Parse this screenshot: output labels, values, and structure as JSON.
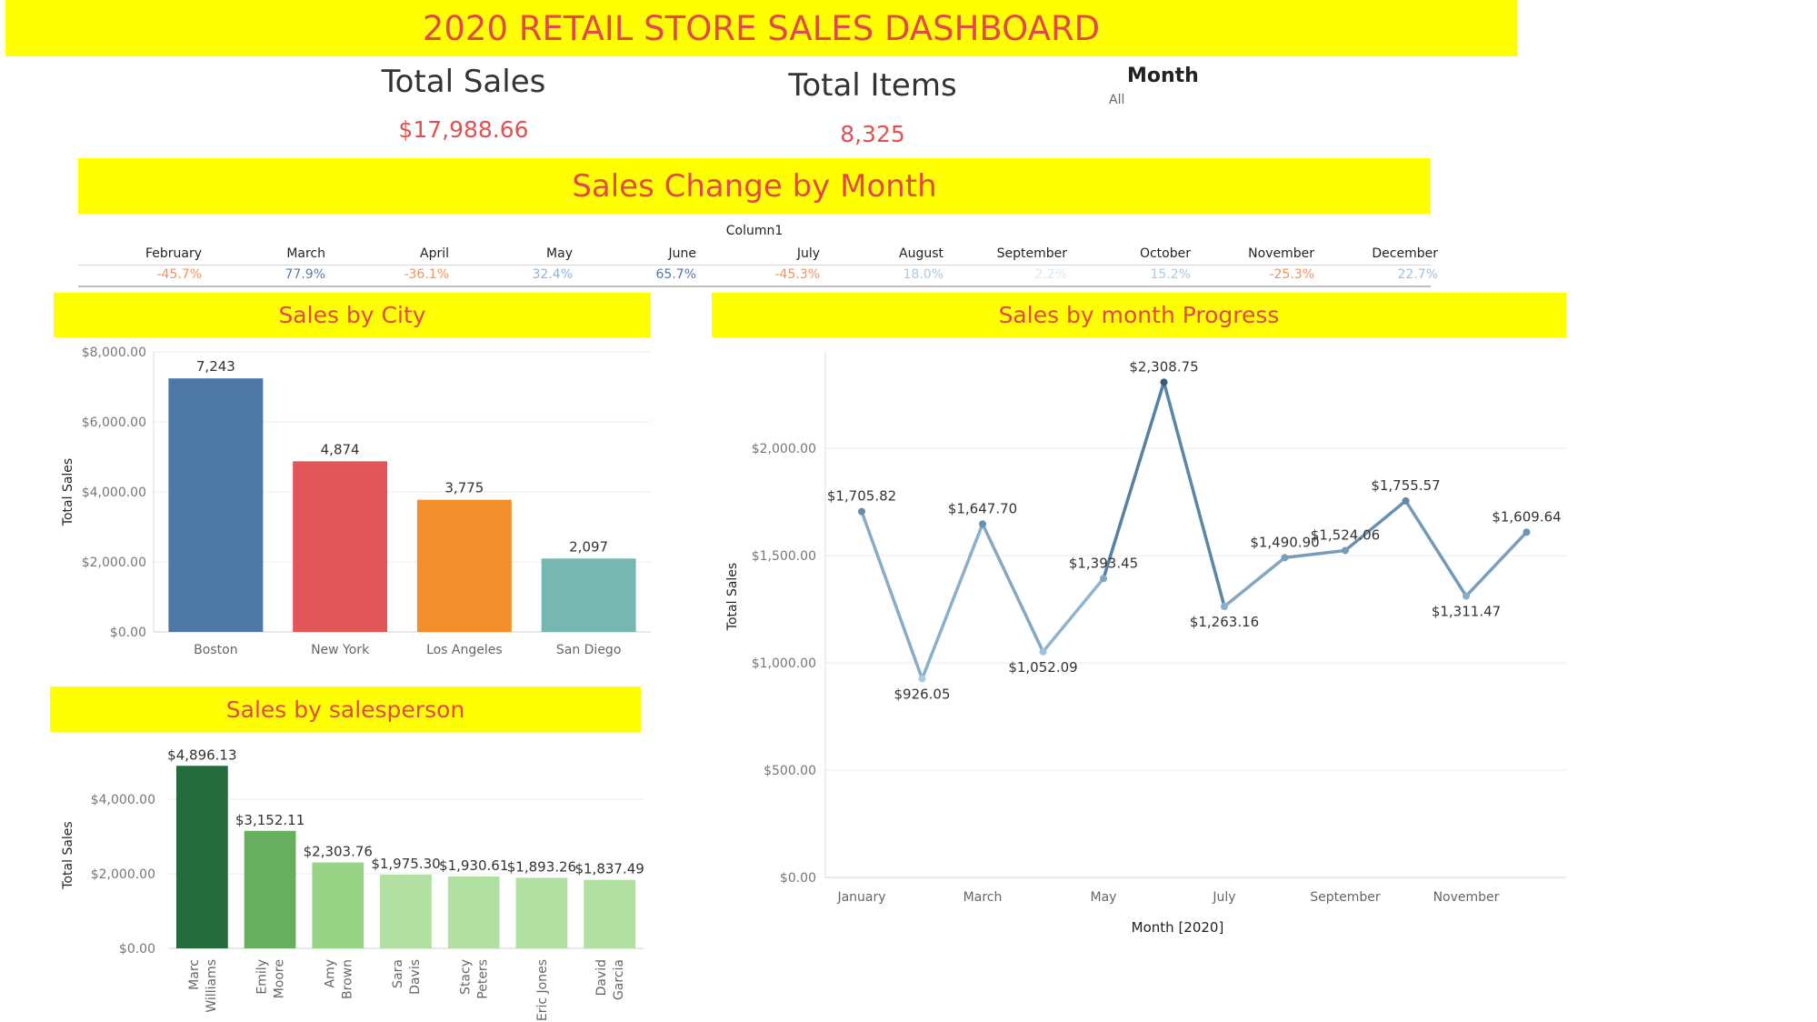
{
  "dashboard": {
    "title": "2020 RETAIL STORE SALES DASHBOARD",
    "kpis": {
      "total_sales_label": "Total Sales",
      "total_sales_value": "$17,988.66",
      "total_items_label": "Total Items",
      "total_items_value": "8,325"
    },
    "filter": {
      "label": "Month",
      "value": "All"
    }
  },
  "sales_change": {
    "title": "Sales Change by Month",
    "column_header": "Column1",
    "months": [
      "February",
      "March",
      "April",
      "May",
      "June",
      "July",
      "August",
      "September",
      "October",
      "November",
      "December"
    ],
    "values": [
      "-45.7%",
      "77.9%",
      "-36.1%",
      "32.4%",
      "65.7%",
      "-45.3%",
      "18.0%",
      "2.2%",
      "15.2%",
      "-25.3%",
      "22.7%"
    ],
    "colors": [
      "#f0935c",
      "#5b7fa6",
      "#f0935c",
      "#8fb4d6",
      "#4f79a8",
      "#f0935c",
      "#a9cce4",
      "#dbe8f1",
      "#a9cce4",
      "#f0935c",
      "#9cc3de"
    ]
  },
  "chart_data": [
    {
      "type": "bar",
      "title": "Sales by City",
      "ylabel": "Total Sales",
      "categories": [
        "Boston",
        "New York",
        "Los Angeles",
        "San Diego"
      ],
      "values": [
        7243,
        4874,
        3775,
        2097
      ],
      "data_labels": [
        "7,243",
        "4,874",
        "3,775",
        "2,097"
      ],
      "colors": [
        "#4e79a7",
        "#e15759",
        "#f28e2b",
        "#76b7b2"
      ],
      "yticks": [
        0,
        2000,
        4000,
        6000,
        8000
      ],
      "ytick_labels": [
        "$0.00",
        "$2,000.00",
        "$4,000.00",
        "$6,000.00",
        "$8,000.00"
      ],
      "ylim": [
        0,
        8000
      ],
      "grid": true
    },
    {
      "type": "bar",
      "title": "Sales by salesperson",
      "ylabel": "Total Sales",
      "categories": [
        "Marc Williams",
        "Emily Moore",
        "Amy Brown",
        "Sara Davis",
        "Stacy Peters",
        "Eric Jones",
        "David Garcia"
      ],
      "category_lines": [
        [
          "Marc",
          "Williams"
        ],
        [
          "Emily",
          "Moore"
        ],
        [
          "Amy",
          "Brown"
        ],
        [
          "Sara",
          "Davis"
        ],
        [
          "Stacy",
          "Peters"
        ],
        [
          "Eric Jones"
        ],
        [
          "David",
          "Garcia"
        ]
      ],
      "values": [
        4896.13,
        3152.11,
        2303.76,
        1975.3,
        1930.61,
        1893.26,
        1837.49
      ],
      "data_labels": [
        "$4,896.13",
        "$3,152.11",
        "$2,303.76",
        "$1,975.30",
        "$1,930.61",
        "$1,893.26",
        "$1,837.49"
      ],
      "colors": [
        "#256b3d",
        "#67ae5f",
        "#98d485",
        "#b2e0a3",
        "#b2e0a3",
        "#b2e0a3",
        "#b2e0a3"
      ],
      "yticks": [
        0,
        2000,
        4000
      ],
      "ytick_labels": [
        "$0.00",
        "$2,000.00",
        "$4,000.00"
      ],
      "ylim": [
        0,
        5000
      ],
      "grid": true
    },
    {
      "type": "line",
      "title": "Sales by month Progress",
      "xlabel": "Month [2020]",
      "ylabel": "Total Sales",
      "x": [
        "January",
        "February",
        "March",
        "April",
        "May",
        "June",
        "July",
        "August",
        "September",
        "October",
        "November",
        "December"
      ],
      "values": [
        1705.82,
        926.05,
        1647.7,
        1052.09,
        1393.45,
        2308.75,
        1263.16,
        1490.9,
        1524.06,
        1755.57,
        1311.47,
        1609.64
      ],
      "data_labels": [
        "$1,705.82",
        "$926.05",
        "$1,647.70",
        "$1,052.09",
        "$1,393.45",
        "$2,308.75",
        "$1,263.16",
        "$1,490.90",
        "$1,524.06",
        "$1,755.57",
        "$1,311.47",
        "$1,609.64"
      ],
      "xtick_labels": [
        "January",
        "",
        "March",
        "",
        "May",
        "",
        "July",
        "",
        "September",
        "",
        "November",
        ""
      ],
      "yticks": [
        0,
        500,
        1000,
        1500,
        2000
      ],
      "ytick_labels": [
        "$0.00",
        "$500.00",
        "$1,000.00",
        "$1,500.00",
        "$2,000.00"
      ],
      "ylim": [
        0,
        2450
      ],
      "color_range": [
        "#a9cce4",
        "#2f5b7f"
      ],
      "grid": true
    }
  ]
}
